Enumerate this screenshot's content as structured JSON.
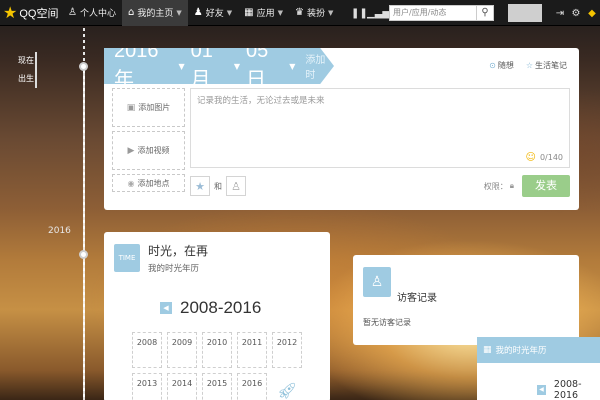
{
  "topbar": {
    "brand": "QQ空间",
    "nav": [
      {
        "label": "个人中心",
        "icon": "person-icon"
      },
      {
        "label": "我的主页",
        "icon": "home-icon",
        "active": true
      },
      {
        "label": "好友",
        "icon": "friends-icon"
      },
      {
        "label": "应用",
        "icon": "apps-icon"
      },
      {
        "label": "装扮",
        "icon": "shirt-icon"
      }
    ],
    "search_placeholder": "用户/应用/动态"
  },
  "side_nav": {
    "now": "现在",
    "birth": "出生"
  },
  "timeline": {
    "year_label": "2016"
  },
  "composer": {
    "year": "2016年",
    "month": "01月",
    "day": "05日",
    "add_time": "添加时",
    "mood_label": "随想",
    "note_label": "生活笔记",
    "add_image": "添加图片",
    "add_video": "添加视频",
    "add_location": "添加地点",
    "placeholder": "记录我的生活，无论过去或是未来",
    "counter": "0/140",
    "and_text": "和",
    "permission_label": "权限：",
    "publish": "发表"
  },
  "timeline_card": {
    "icon_text": "TIME",
    "title": "时光，在再",
    "subtitle": "我的时光年历",
    "range": "2008-2016",
    "years": [
      "2008",
      "2009",
      "2010",
      "2011",
      "2012",
      "2013",
      "2014",
      "2015",
      "2016"
    ]
  },
  "visitor_card": {
    "title": "访客记录",
    "empty": "暂无访客记录"
  },
  "float_panel": {
    "title": "我的时光年历",
    "range": "2008-2016"
  },
  "colors": {
    "accent_blue": "#9fcbe2",
    "publish_green": "#9acd8a",
    "topbar": "#1b1b1b"
  }
}
